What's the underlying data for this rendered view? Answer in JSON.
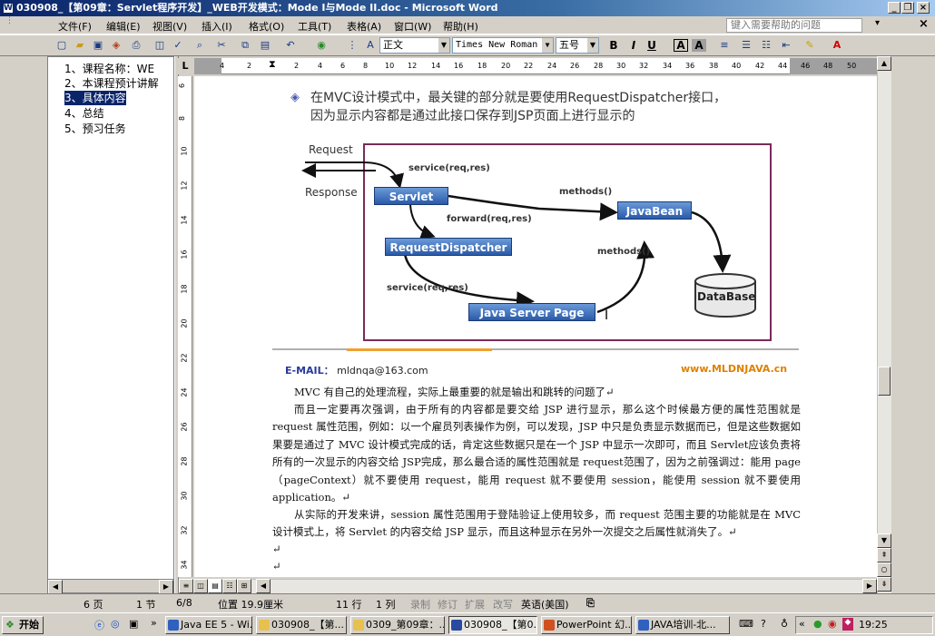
{
  "window": {
    "title": "030908_【第09章：Servlet程序开发】_WEB开发模式：Mode I与Mode II.doc - Microsoft Word"
  },
  "menu": {
    "items": [
      "文件(F)",
      "编辑(E)",
      "视图(V)",
      "插入(I)",
      "格式(O)",
      "工具(T)",
      "表格(A)",
      "窗口(W)",
      "帮助(H)"
    ],
    "help_placeholder": "键入需要帮助的问题"
  },
  "toolbar": {
    "style": "正文",
    "font": "Times New Roman",
    "size": "五号",
    "bold": "B",
    "italic": "I",
    "underline": "U",
    "char_border": "A",
    "char_shade": "A",
    "close_x": "×"
  },
  "ruler": {
    "marks": [
      "4",
      "2",
      "2",
      "4",
      "6",
      "8",
      "10",
      "12",
      "14",
      "16",
      "18",
      "20",
      "22",
      "24",
      "26",
      "28",
      "30",
      "32",
      "34",
      "36",
      "38",
      "40",
      "42",
      "44",
      "46",
      "48",
      "50"
    ],
    "vmarks": [
      "6",
      "8",
      "10",
      "12",
      "14",
      "16",
      "18",
      "20",
      "22",
      "24",
      "26",
      "28",
      "30",
      "32",
      "34"
    ],
    "tab_stop": "L"
  },
  "nav": {
    "items": [
      "1、课程名称：WE",
      "2、本课程预计讲解",
      "3、具体内容",
      "4、总结",
      "5、预习任务"
    ]
  },
  "slide": {
    "line1": "在MVC设计模式中，最关键的部分就是要使用RequestDispatcher接口，",
    "line2": "因为显示内容都是通过此接口保存到JSP页面上进行显示的",
    "diagram": {
      "request": "Request",
      "response": "Response",
      "servlet": "Servlet",
      "javabean": "JavaBean",
      "dispatcher": "RequestDispatcher",
      "jsp": "Java Server Page",
      "database": "DataBase",
      "service1": "service(req,res)",
      "forward": "forward(req,res)",
      "methods1": "methods()",
      "methods2": "methods()",
      "service2": "service(req,res)"
    },
    "email_label": "E-MAIL：",
    "email": "mldnqa@163.com",
    "site": "www.MLDNJAVA.cn"
  },
  "body": {
    "p1": "MVC 有自己的处理流程，实际上最重要的就是输出和跳转的问题了↵",
    "p2": "而且一定要再次强调，由于所有的内容都是要交给 JSP 进行显示，那么这个时候最方便的属性范围就是 request 属性范围，例如：以一个雇员列表操作为例，可以发现，JSP 中只是负责显示数据而已，但是这些数据如果要是通过了 MVC 设计模式完成的话，肯定这些数据只是在一个 JSP 中显示一次即可，而且 Servlet应该负责将所有的一次显示的内容交给 JSP完成，那么最合适的属性范围就是 request范围了，因为之前强调过：能用 page（pageContext）就不要使用 request，能用 request 就不要使用 session，能使用 session 就不要使用 application。↵",
    "p3": "从实际的开发来讲，session 属性范围用于登陆验证上使用较多，而 request 范围主要的功能就是在 MVC 设计模式上，将 Servlet 的内容交给 JSP 显示，而且这种显示在另外一次提交之后属性就消失了。↵",
    "p4": "↵",
    "p5": "↵"
  },
  "status": {
    "page": "6 页",
    "section": "1 节",
    "pages": "6/8",
    "position": "位置 19.9厘米",
    "line": "11 行",
    "col": "1 列",
    "rec": "录制",
    "trk": "修订",
    "ext": "扩展",
    "ovr": "改写",
    "lang": "英语(美国)"
  },
  "taskbar": {
    "start": "开始",
    "tasks": [
      "Java EE 5 - Wi...",
      "030908_【第...",
      "0309_第09章：...",
      "030908_【第0...",
      "PowerPoint 幻...",
      "JAVA培训-北..."
    ],
    "clock": "19:25"
  }
}
